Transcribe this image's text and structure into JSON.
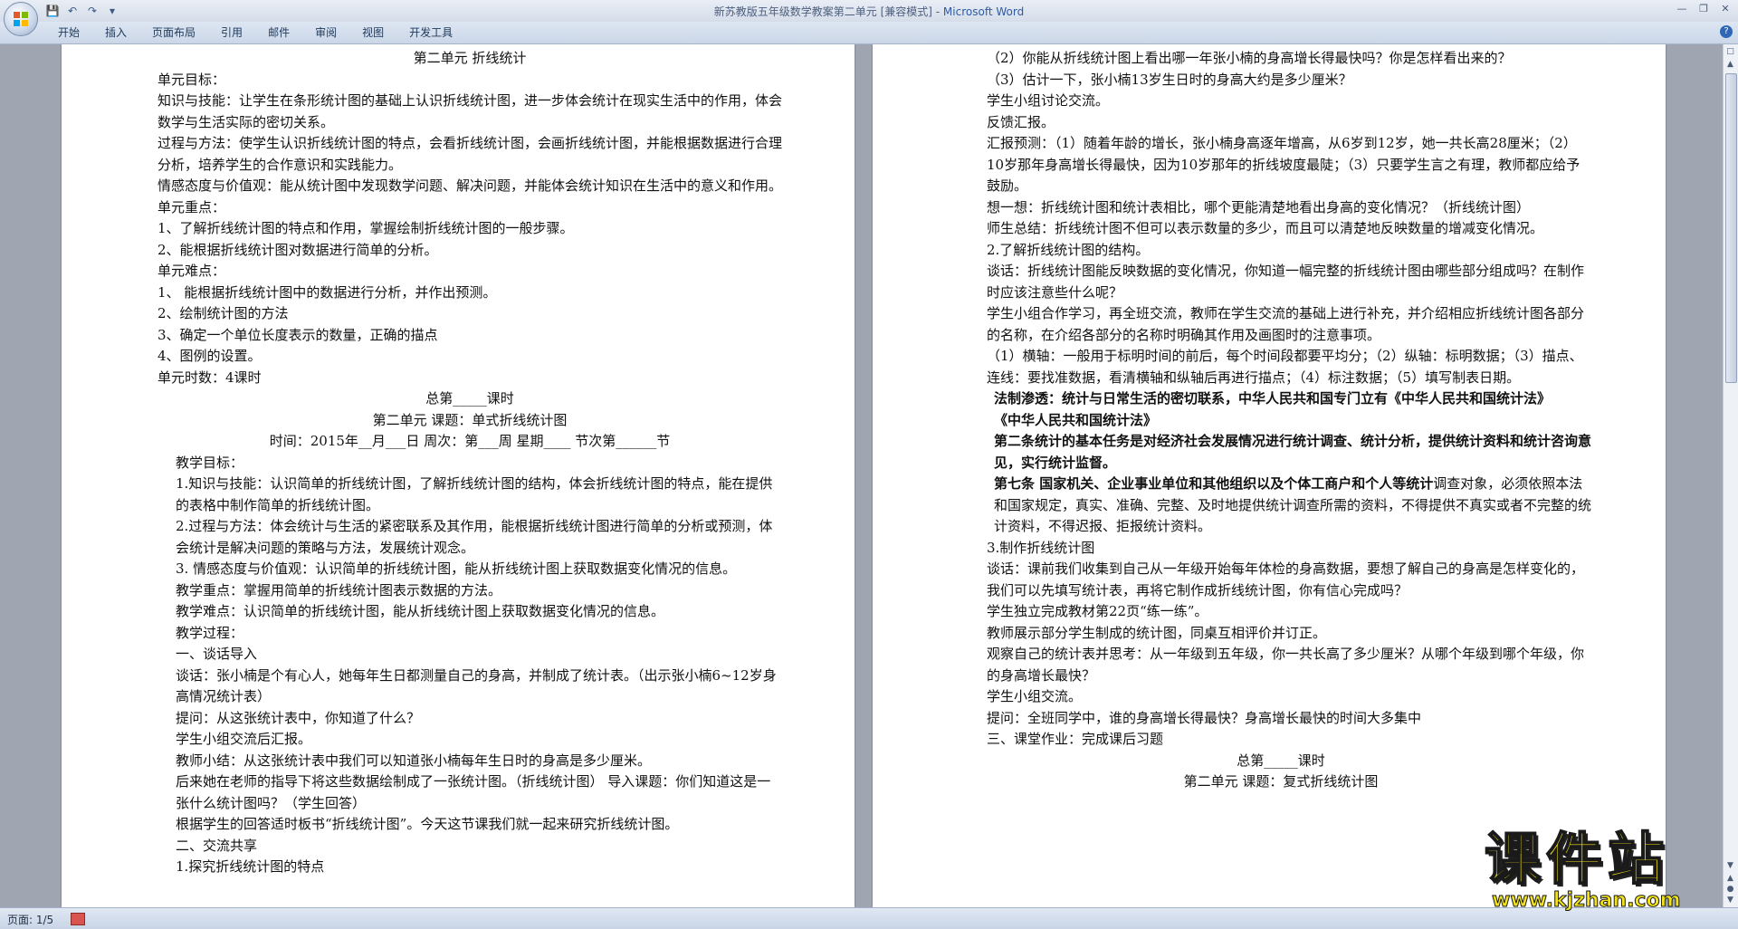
{
  "window": {
    "title": "新苏教版五年级数学教案第二单元 [兼容模式] - ",
    "app_name": "Microsoft Word"
  },
  "ribbon": {
    "tabs": [
      "开始",
      "插入",
      "页面布局",
      "引用",
      "邮件",
      "审阅",
      "视图",
      "开发工具"
    ]
  },
  "left_page": [
    {
      "t": "第二单元               折线统计",
      "s": "c"
    },
    {
      "t": "  单元目标：",
      "s": ""
    },
    {
      "t": "知识与技能：让学生在条形统计图的基础上认识折线统计图，进一步体会统计在现实生活中的作用，体会数学与生活实际的密切关系。",
      "s": ""
    },
    {
      "t": "过程与方法：使学生认识折线统计图的特点，会看折线统计图，会画折线统计图，并能根据数据进行合理分析，培养学生的合作意识和实践能力。",
      "s": ""
    },
    {
      "t": "情感态度与价值观：能从统计图中发现数学问题、解决问题，并能体会统计知识在生活中的意义和作用。",
      "s": ""
    },
    {
      "t": "单元重点：",
      "s": ""
    },
    {
      "t": "1、了解折线统计图的特点和作用，掌握绘制折线统计图的一般步骤。",
      "s": ""
    },
    {
      "t": "2、能根据折线统计图对数据进行简单的分析。",
      "s": ""
    },
    {
      "t": "单元难点：",
      "s": ""
    },
    {
      "t": "1、 能根据折线统计图中的数据进行分析，并作出预测。",
      "s": ""
    },
    {
      "t": "2、绘制统计图的方法",
      "s": ""
    },
    {
      "t": "3、确定一个单位长度表示的数量，正确的描点",
      "s": ""
    },
    {
      "t": "4、图例的设置。",
      "s": ""
    },
    {
      "t": "单元时数：4课时",
      "s": ""
    },
    {
      "t": "总第_____课时",
      "s": "c"
    },
    {
      "t": "第二单元 课题：单式折线统计图",
      "s": "c"
    },
    {
      "t": "时间：2015年__月___日 周次：第___周 星期____ 节次第______节",
      "s": "c"
    },
    {
      "t": "教学目标：",
      "s": "i1"
    },
    {
      "t": "1.知识与技能：认识简单的折线统计图，了解折线统计图的结构，体会折线统计图的特点，能在提供的表格中制作简单的折线统计图。",
      "s": "i1"
    },
    {
      "t": "2.过程与方法：体会统计与生活的紧密联系及其作用，能根据折线统计图进行简单的分析或预测，体会统计是解决问题的策略与方法，发展统计观念。",
      "s": "i1"
    },
    {
      "t": "3. 情感态度与价值观：认识简单的折线统计图，能从折线统计图上获取数据变化情况的信息。",
      "s": "i1"
    },
    {
      "t": "教学重点：掌握用简单的折线统计图表示数据的方法。",
      "s": "i1"
    },
    {
      "t": "教学难点：认识简单的折线统计图，能从折线统计图上获取数据变化情况的信息。",
      "s": "i1"
    },
    {
      "t": "教学过程：",
      "s": "i1"
    },
    {
      "t": "一、谈话导入",
      "s": "i1"
    },
    {
      "t": "谈话：张小楠是个有心人，她每年生日都测量自己的身高，并制成了统计表。（出示张小楠6~12岁身高情况统计表）",
      "s": "i1"
    },
    {
      "t": "提问：从这张统计表中，你知道了什么？",
      "s": "i1"
    },
    {
      "t": "学生小组交流后汇报。",
      "s": "i1"
    },
    {
      "t": "教师小结：从这张统计表中我们可以知道张小楠每年生日时的身高是多少厘米。",
      "s": "i1"
    },
    {
      "t": "后来她在老师的指导下将这些数据绘制成了一张统计图。（折线统计图） 导入课题：你们知道这是一张什么统计图吗？（学生回答）",
      "s": "i1"
    },
    {
      "t": "根据学生的回答适时板书“折线统计图”。今天这节课我们就一起来研究折线统计图。",
      "s": "i1"
    },
    {
      "t": "二、交流共享",
      "s": "i1"
    },
    {
      "t": "1.探究折线统计图的特点",
      "s": "i1"
    }
  ],
  "right_page": [
    {
      "t": "（2）你能从折线统计图上看出哪一年张小楠的身高增长得最快吗？你是怎样看出来的？",
      "s": "i1"
    },
    {
      "t": "（3）估计一下，张小楠13岁生日时的身高大约是多少厘米？",
      "s": "i1"
    },
    {
      "t": "学生小组讨论交流。",
      "s": "i1"
    },
    {
      "t": "反馈汇报。",
      "s": "i1"
    },
    {
      "t": "汇报预测：（1）随着年龄的增长，张小楠身高逐年增高，从6岁到12岁，她一共长高28厘米；（2）10岁那年身高增长得最快，因为10岁那年的折线坡度最陡；（3）只要学生言之有理，教师都应给予鼓励。",
      "s": "i1"
    },
    {
      "t": "想一想：折线统计图和统计表相比，哪个更能清楚地看出身高的变化情况？（折线统计图）",
      "s": "i1"
    },
    {
      "t": "师生总结：折线统计图不但可以表示数量的多少，而且可以清楚地反映数量的增减变化情况。",
      "s": "i1"
    },
    {
      "t": "2.了解折线统计图的结构。",
      "s": "i1"
    },
    {
      "t": "谈话：折线统计图能反映数据的变化情况，你知道一幅完整的折线统计图由哪些部分组成吗？在制作时应该注意些什么呢？",
      "s": "i1"
    },
    {
      "t": "学生小组合作学习，再全班交流，教师在学生交流的基础上进行补充，并介绍相应折线统计图各部分的名称，在介绍各部分的名称时明确其作用及画图时的注意事项。",
      "s": "i1"
    },
    {
      "t": "（1）横轴：一般用于标明时间的前后，每个时间段都要平均分；（2）纵轴：标明数据；（3）描点、连线：要找准数据，看清横轴和纵轴后再进行描点；（4）标注数据；（5）填写制表日期。",
      "s": "i1"
    },
    {
      "t": "法制渗透：统计与日常生活的密切联系，中华人民共和国专门立有《中华人民共和国统计法》",
      "s": "i2 b"
    },
    {
      "t": "《中华人民共和国统计法》",
      "s": "i2 b"
    },
    {
      "t": "第二条统计的基本任务是对经济社会发展情况进行统计调查、统计分析，提供统计资料和统计咨询意见，实行统计监督。",
      "s": "i2 b"
    },
    {
      "t": "第七条 国家机关、企业事业单位和其他组织以及个体工商户和个人等统计调查对象，必须依照本法和国家规定，真实、准确、完整、及时地提供统计调查所需的资料，不得提供不真实或者不完整的统计资料，不得迟报、拒报统计资料。",
      "s": "i2 mixed"
    },
    {
      "t": "3.制作折线统计图",
      "s": "i1"
    },
    {
      "t": "谈话：课前我们收集到自己从一年级开始每年体检的身高数据，要想了解自己的身高是怎样变化的，我们可以先填写统计表，再将它制作成折线统计图，你有信心完成吗？",
      "s": "i1"
    },
    {
      "t": "学生独立完成教材第22页“练一练”。",
      "s": "i1"
    },
    {
      "t": "教师展示部分学生制成的统计图，同桌互相评价并订正。",
      "s": "i1"
    },
    {
      "t": "观察自己的统计表并思考：从一年级到五年级，你一共长高了多少厘米？从哪个年级到哪个年级，你的身高增长最快？",
      "s": "i1"
    },
    {
      "t": "学生小组交流。",
      "s": "i1"
    },
    {
      "t": "提问：全班同学中，谁的身高增长得最快？身高增长最快的时间大多集中",
      "s": "i1"
    },
    {
      "t": "三、课堂作业：完成课后习题",
      "s": "i1"
    },
    {
      "t": " ",
      "s": "c"
    },
    {
      "t": "总第_____课时",
      "s": "c"
    },
    {
      "t": "第二单元 课题：复式折线统计图",
      "s": "c"
    }
  ],
  "status": {
    "page_label": "页面: 1/5"
  },
  "watermark": {
    "main": "课件站",
    "url": "www.kjzhan.com"
  }
}
